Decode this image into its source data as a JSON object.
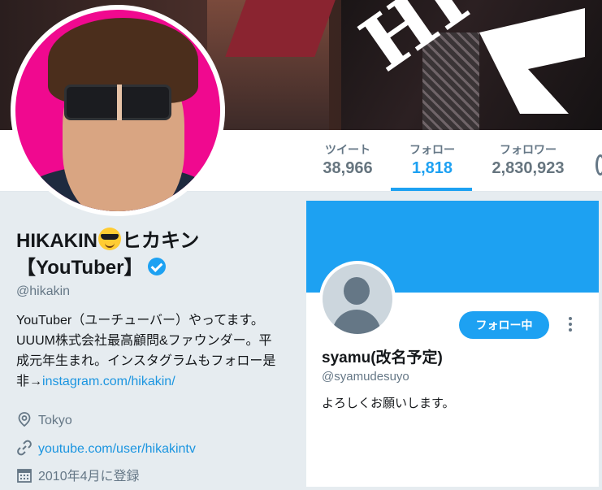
{
  "stats": {
    "tweets": {
      "label": "ツイート",
      "value": "38,966"
    },
    "following": {
      "label": "フォロー",
      "value": "1,818"
    },
    "followers": {
      "label": "フォロワー",
      "value": "2,830,923"
    }
  },
  "profile": {
    "name_part1": "HIKAKIN",
    "name_part2": "ヒカキン",
    "name_line2": "【YouTuber】",
    "handle": "@hikakin",
    "bio_text": "YouTuber（ユーチューバー）やってます。UUUM株式会社最高顧問&ファウンダー。平成元年生まれ。インスタグラムもフォロー是非→",
    "bio_link": "instagram.com/hikakin/",
    "location": "Tokyo",
    "url": "youtube.com/user/hikakintv",
    "joined": "2010年4月に登録"
  },
  "banner": {
    "brand_text": "HI"
  },
  "card": {
    "name": "syamu(改名予定)",
    "handle": "@syamudesuyo",
    "bio": "よろしくお願いします。",
    "follow_label": "フォロー中"
  },
  "colors": {
    "accent": "#1da1f2",
    "avatar_bg": "#f0098f"
  }
}
